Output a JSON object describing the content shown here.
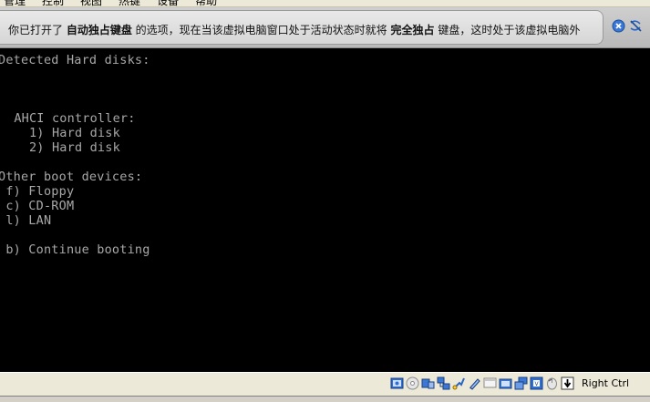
{
  "menubar": {
    "items": [
      "管理",
      "控制",
      "视图",
      "热键",
      "设备",
      "帮助"
    ]
  },
  "notice": {
    "part1": "你已打开了 ",
    "bold1": "自动独占键盘",
    "part2": " 的选项，现在当该虚拟电脑窗口处于活动状态时就将 ",
    "bold2": "完全独占",
    "part3": " 键盘，这时处于该虚拟电脑外",
    "close_icon": "close-icon",
    "no_autoshow_icon": "do-not-show-again-icon"
  },
  "console": {
    "lines": [
      "Detected Hard disks:",
      "",
      "",
      "",
      " AHCI controller:",
      "   1) Hard disk",
      "   2) Hard disk",
      "",
      "Other boot devices:",
      " f) Floppy",
      " c) CD-ROM",
      " l) LAN",
      "",
      " b) Continue booting"
    ]
  },
  "statusbar": {
    "icons": [
      "hard-disk-icon",
      "optical-drive-icon",
      "audio-icon",
      "network-icon",
      "usb-icon",
      "shared-folders-icon",
      "display-icon",
      "video-capture-icon",
      "virtualization-icon",
      "mouse-integration-icon",
      "host-key-arrow-icon"
    ],
    "host_key": "Right Ctrl"
  },
  "colors": {
    "console_bg": "#000000",
    "console_text": "#a8a8a8",
    "notice_bg": "#d9d9d9",
    "statusbar_bg": "#ece9d8"
  }
}
